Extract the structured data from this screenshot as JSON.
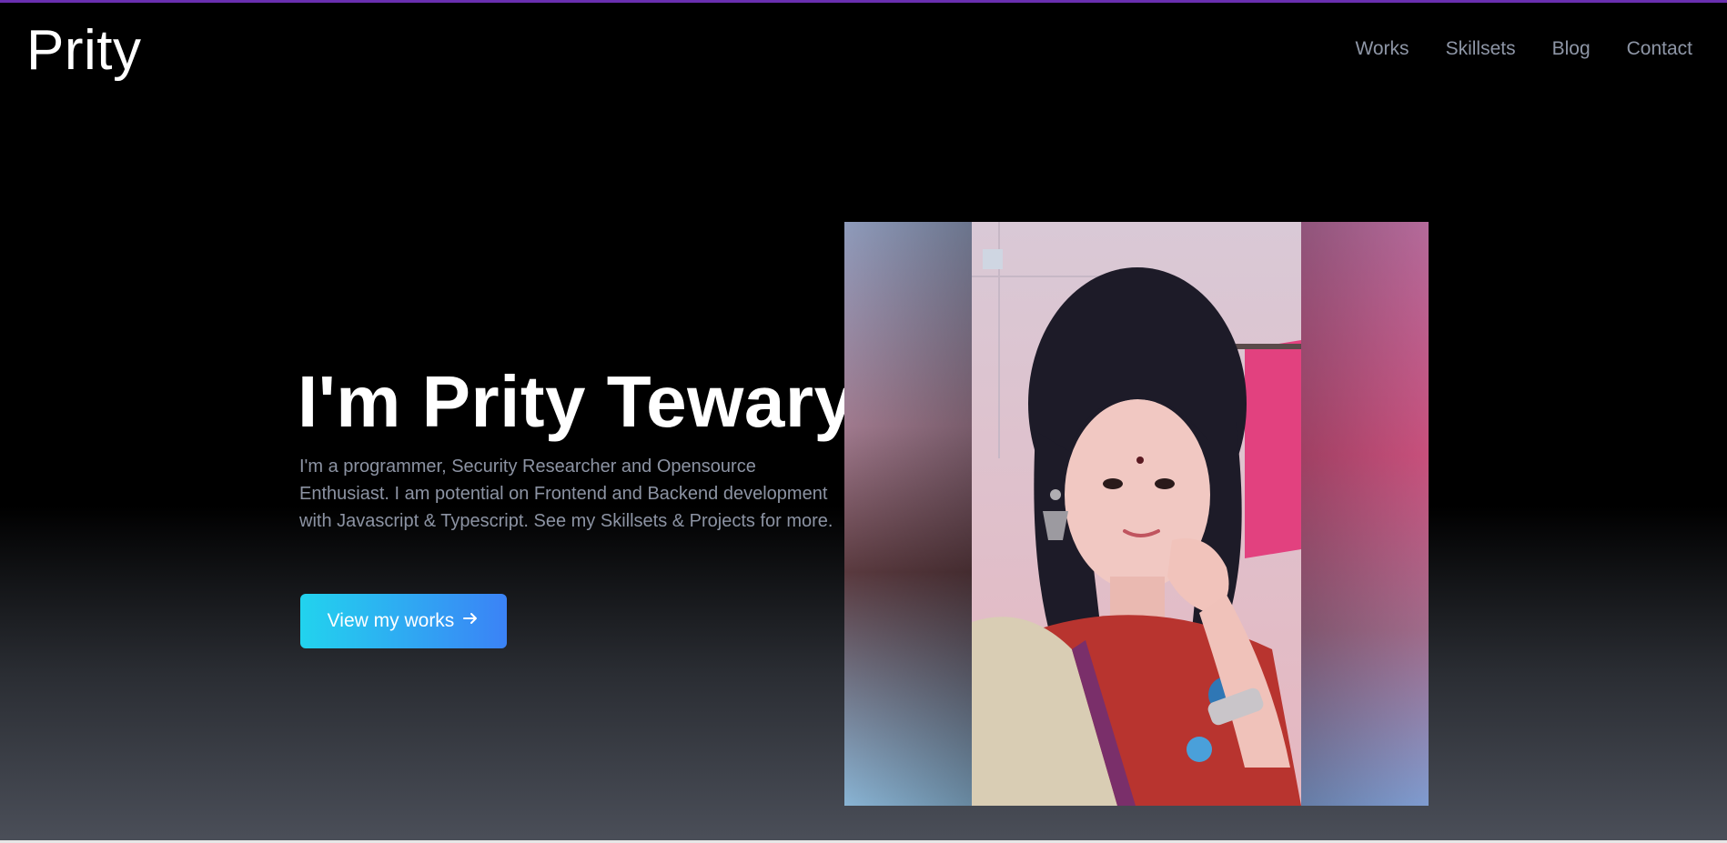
{
  "site": {
    "logo": "Prity"
  },
  "nav": {
    "items": [
      {
        "label": "Works"
      },
      {
        "label": "Skillsets"
      },
      {
        "label": "Blog"
      },
      {
        "label": "Contact"
      }
    ]
  },
  "hero": {
    "title": "I'm Prity Tewary",
    "description": "I'm a programmer, Security Researcher and Opensource Enthusiast. I am potential on Frontend and Backend development with Javascript & Typescript. See my Skillsets & Projects for more.",
    "cta_label": "View my works",
    "cta_icon": "arrow-right-icon"
  },
  "colors": {
    "accent_bar": "#6a2fb0",
    "cta_gradient_start": "#22d3ee",
    "cta_gradient_end": "#3b82f6",
    "nav_text": "#8e96a6",
    "body_text": "#8c93a3"
  }
}
